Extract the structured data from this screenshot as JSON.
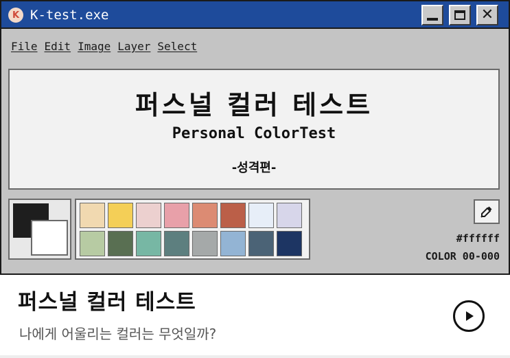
{
  "window": {
    "title": "K-test.exe",
    "app_icon_letter": "K"
  },
  "menu": [
    "File",
    "Edit",
    "Image",
    "Layer",
    "Select"
  ],
  "canvas": {
    "title": "퍼스널 컬러 테스트",
    "subtitle": "Personal ColorTest",
    "tag": "-성격편-"
  },
  "colors": {
    "titlebar": "#1e4b9b",
    "foreground": "#1e1e1e",
    "background": "#ffffff"
  },
  "palette": [
    [
      "#f1d9b0",
      "#f4cf57",
      "#ecd0cf",
      "#e8a0a9",
      "#dc8b73",
      "#bb5f48",
      "#e7eef8",
      "#d7d6ea"
    ],
    [
      "#b7cba3",
      "#596f52",
      "#77b7a4",
      "#5d7f7f",
      "#a5a9a9",
      "#93b4d4",
      "#4b6376",
      "#1d3563"
    ]
  ],
  "tools": {
    "hex_value": "#ffffff",
    "color_code": "COLOR 00-000",
    "eyedropper_icon": "eyedropper-icon"
  },
  "card": {
    "title": "퍼스널 컬러 테스트",
    "subtitle": "나에게 어울리는 컬러는 무엇일까?",
    "play_icon": "play-icon"
  }
}
